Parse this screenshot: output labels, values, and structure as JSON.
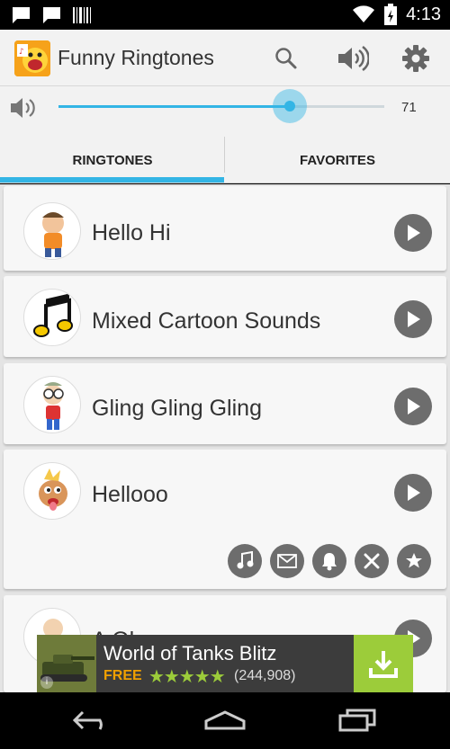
{
  "status_bar": {
    "time": "4:13"
  },
  "app": {
    "title": "Funny Ringtones"
  },
  "volume": {
    "value": "71",
    "level": 0.71
  },
  "tabs": [
    {
      "label": "RINGTONES",
      "active": true
    },
    {
      "label": "FAVORITES",
      "active": false
    }
  ],
  "ringtones": [
    {
      "title": "Hello Hi"
    },
    {
      "title": "Mixed Cartoon Sounds"
    },
    {
      "title": "Gling Gling Gling"
    },
    {
      "title": "Hellooo"
    },
    {
      "title": "A Oh"
    }
  ],
  "actions": [
    "music-note-icon",
    "message-icon",
    "bell-icon",
    "close-icon",
    "star-icon"
  ],
  "ad": {
    "title": "World of Tanks Blitz",
    "price": "FREE",
    "stars": "★★★★★",
    "rating_count": "(244,908)",
    "info": "i"
  },
  "colors": {
    "accent": "#33b5e5",
    "ad_download": "#9ccc3a",
    "play_button": "#6d6d6d"
  }
}
